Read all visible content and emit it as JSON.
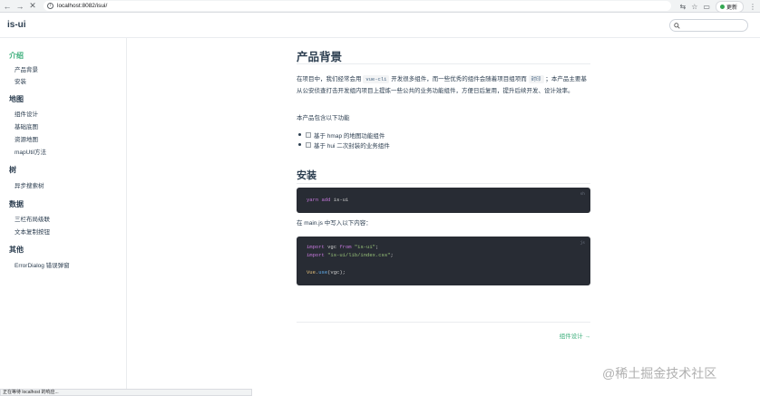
{
  "browser": {
    "back_icon": "arrow-left-icon",
    "forward_icon": "arrow-right-icon",
    "reload_icon": "close-icon",
    "url": "localhost:8082/isui/",
    "update_label": "更新",
    "status_text": "正在等待 localhost 的响应..."
  },
  "navbar": {
    "site_name": "is-ui",
    "search_placeholder": ""
  },
  "sidebar": {
    "groups": [
      {
        "title": "介绍",
        "items": [
          "产品背景",
          "安装"
        ]
      },
      {
        "title": "地图",
        "items": [
          "组件设计",
          "基础底图",
          "资源地图",
          "mapUtil方法"
        ]
      },
      {
        "title": "树",
        "items": [
          "异步搜索树"
        ]
      },
      {
        "title": "数据",
        "items": [
          "三栏布局级联",
          "文本复制按钮"
        ]
      },
      {
        "title": "其他",
        "items": [
          "ErrorDialog 错误弹窗"
        ]
      }
    ]
  },
  "main": {
    "title": "产品背景",
    "intro_before": "在项目中，我们经常会用 ",
    "intro_code": "vue-cli",
    "intro_middle": " 开发很多组件，而一些优秀的组件会随着项目组项而 ",
    "intro_code2": "封印",
    "intro_after": " ；本产品主要基从公安侦查打击开发组内项目上提炼一些公共的业务功能组件，方便日后复用，提升后续开发、设计效率。",
    "features_heading": "本产品包含以下功能",
    "features": [
      "基于 hmap 的地图功能组件",
      "基于 hui 二次封装的业务组件"
    ],
    "install_title": "安装",
    "install_lang": "sh",
    "install_cmd_keyword": "yarn add",
    "install_cmd_pkg": "is-ui",
    "mainjs_text": "在 main.js 中写入以下内容：",
    "code_lang": "js",
    "code": {
      "line1_import": "import",
      "line1_id": "vgc",
      "line1_from": "from",
      "line1_str": "\"is-ui\"",
      "line1_end": ";",
      "line2_import": "import",
      "line2_str": "\"is-ui/lib/index.css\"",
      "line2_end": ";",
      "line3_obj": "Vue",
      "line3_fn": "use",
      "line3_arg": "(vgc);"
    },
    "next_link": "组件设计 →"
  },
  "watermark": {
    "text": "@稀土掘金技术社区"
  }
}
